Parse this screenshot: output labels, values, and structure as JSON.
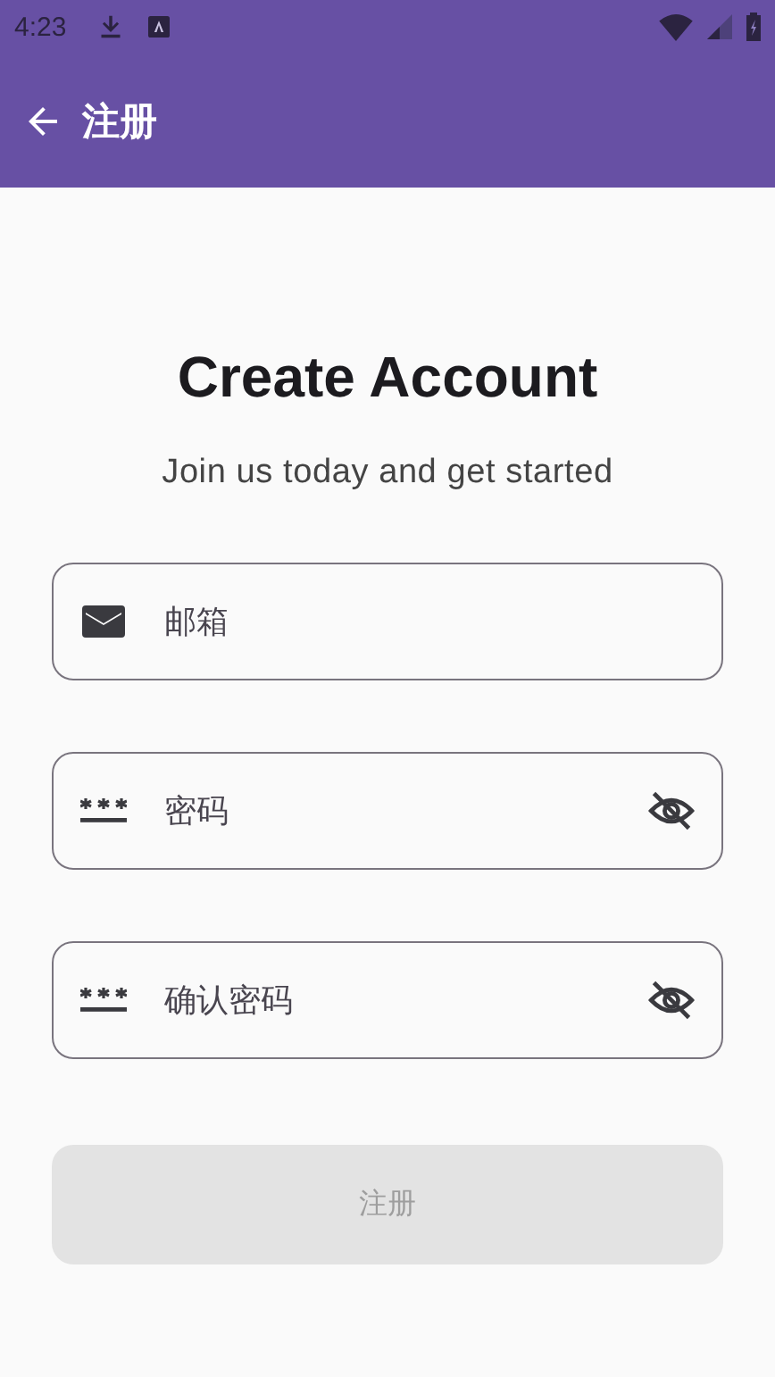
{
  "status_bar": {
    "time": "4:23"
  },
  "app_bar": {
    "title": "注册"
  },
  "heading": "Create Account",
  "subtitle": "Join us today and get started",
  "fields": [
    {
      "kind": "email",
      "placeholder": "邮箱"
    },
    {
      "kind": "password",
      "placeholder": "密码",
      "visibility_toggle": true
    },
    {
      "kind": "password",
      "placeholder": "确认密码",
      "visibility_toggle": true
    }
  ],
  "submit_button": {
    "label": "注册",
    "disabled": true
  }
}
